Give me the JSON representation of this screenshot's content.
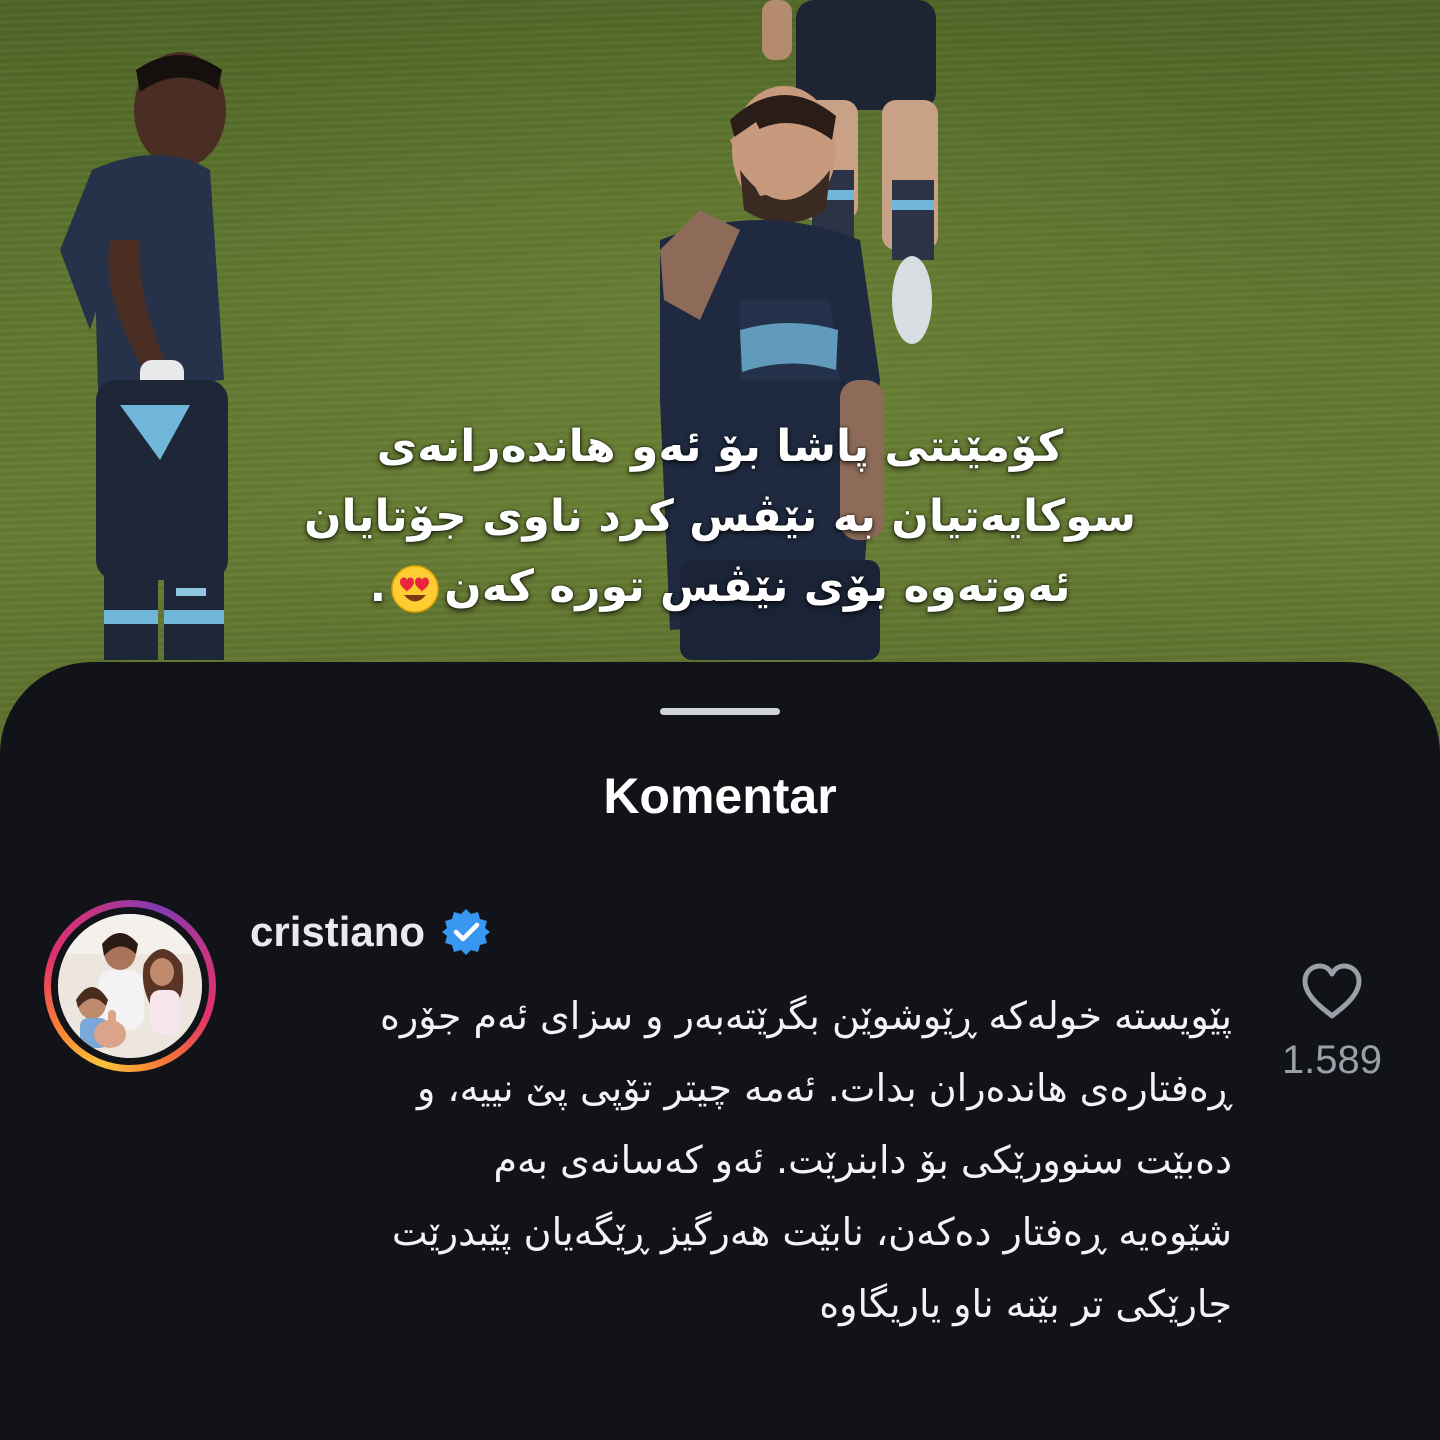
{
  "caption": {
    "line1": "کۆمێنتی پاشا بۆ ئەو هاندەرانەی",
    "line2": "سوکایەتیان بە نێڤس کرد  ناوی جۆتایان",
    "line3": "ئەوتەوە بۆی نێڤس تورە کەن",
    "line3_end": ".",
    "emoji": "smiling-face-with-heart-eyes"
  },
  "sheet": {
    "title": "Komentar"
  },
  "comment": {
    "username": "cristiano",
    "verified": true,
    "text_lines": [
      "پێویستە خولەکە ڕێوشوێن بگرێتەبەر و سزای ئەم جۆرە",
      "ڕەفتارەی هاندەران بدات. ئەمە چیتر تۆپی پێ نییە، و",
      "دەبێت  سنوورێکی  بۆ  دابنرێت.  ئەو کەسانەی  بەم",
      "شێوەیە ڕەفتار دەکەن، نابێت هەرگیز ڕێگەیان پێبدرێت",
      "جارێکی تر بێنە ناو یاریگاوە"
    ],
    "like_count": "1.589"
  },
  "colors": {
    "sheet_bg": "#111318",
    "verified_blue": "#3897f0",
    "muted_text": "#9aa0a8"
  }
}
